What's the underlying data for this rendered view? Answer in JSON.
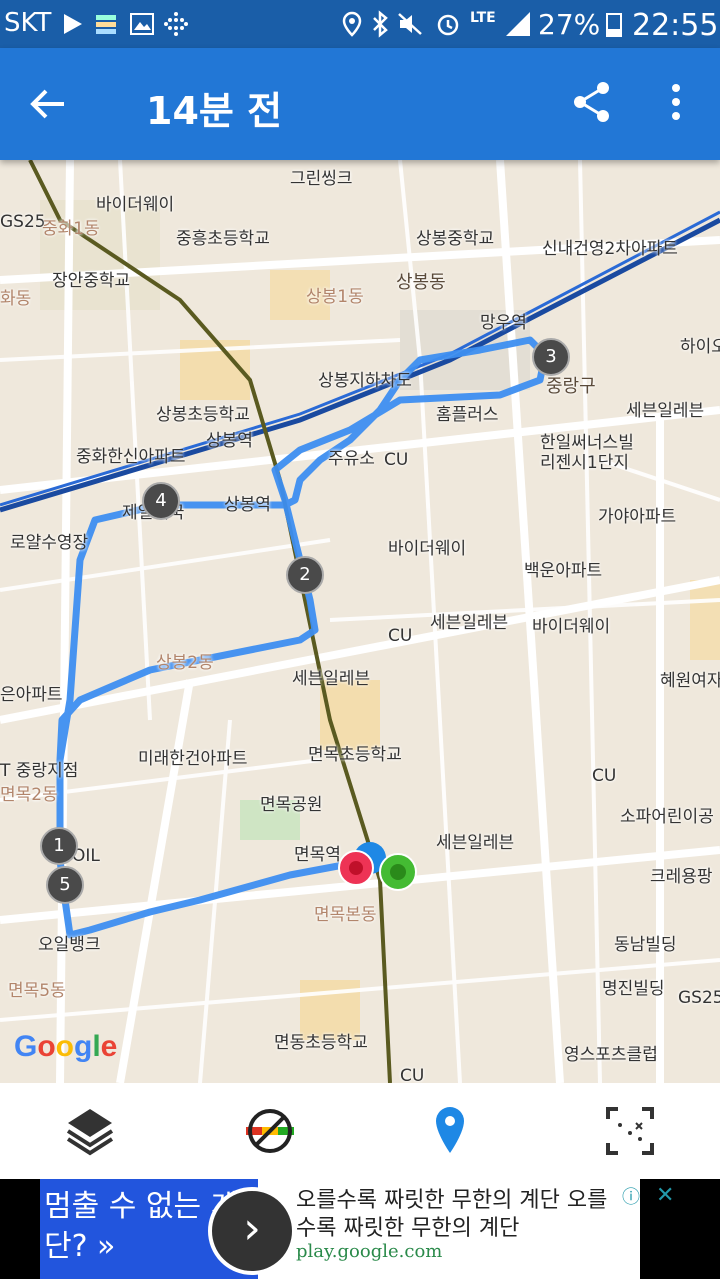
{
  "status_bar": {
    "carrier": "SKT",
    "battery": "27%",
    "time": "22:55",
    "network": "LTE"
  },
  "toolbar": {
    "title": "14분 전"
  },
  "map": {
    "labels": {
      "greensink": "그린씽크",
      "baidu1": "바이더웨이",
      "gs25_top": "GS25",
      "junghwa1": "중화1동",
      "junghung_school": "중흥초등학교",
      "sangbong_mid": "상봉중학교",
      "sinnae": "신내건영2차아파트",
      "jangan_school": "장안중학교",
      "sangbong_dong": "상봉동",
      "sangbong1": "상봉1동",
      "hwadong": "화동",
      "mangu": "망우역",
      "haio": "하이오",
      "sangbong_underpass": "상봉지하차도",
      "junglang": "중랑구",
      "homeplus": "홈플러스",
      "seven1": "세븐일레븐",
      "sangbong_elem": "상봉초등학교",
      "sangbong_station": "상봉역",
      "junghwa_apt": "중화한신아파트",
      "gas": "주유소",
      "cu1": "CU",
      "hanil": "한일써너스빌",
      "hanil2": "리젠시1단지",
      "jeil": "제일제국",
      "sangbong_station2": "상봉역",
      "gaya": "가야아파트",
      "royal": "로얄수영장",
      "baidu2": "바이더웨이",
      "baekun": "백운아파트",
      "seven2": "세븐일레븐",
      "baidu3": "바이더웨이",
      "cu2": "CU",
      "sangbong2": "상봉2동",
      "seven3": "세븐일레븐",
      "hyewon": "혜원여자",
      "eun_apt": "은아파트",
      "mirae": "미래한건아파트",
      "myeonmok_elem": "면목초등학교",
      "jungnang_t": "T 중랑지점",
      "myeonmok2": "면목2동",
      "cu3": "CU",
      "myeonmok_park": "면목공원",
      "sopa": "소파어린이공",
      "oil": "OIL",
      "seven4": "세븐일레븐",
      "myeonmok_station": "면목역",
      "creyong": "크레용팡",
      "myeonmok_bon": "면목본동",
      "oil2": "오일뱅크",
      "dongnam": "동남빌딩",
      "myeonmok5": "면목5동",
      "myeongjin": "명진빌딩",
      "gs25_bottom": "GS25",
      "myeondong_elem": "면동초등학교",
      "young": "영스포츠클럽",
      "cu4": "CU",
      "google": "Google"
    },
    "markers": [
      "1",
      "2",
      "3",
      "4",
      "5"
    ],
    "route_color": "#3d8ef0",
    "start_color": "#ee3355",
    "end_color": "#44bb33"
  },
  "bottom_nav": {
    "icons": [
      "layers-icon",
      "traffic-icon",
      "location-pin-icon",
      "fullscreen-scan-icon"
    ]
  },
  "ad": {
    "left_text": "멈출 수 없는 계단? »",
    "headline": "오를수록 짜릿한 무한의 계단 오를수록 짜릿한 무한의 계단",
    "url": "play.google.com"
  }
}
